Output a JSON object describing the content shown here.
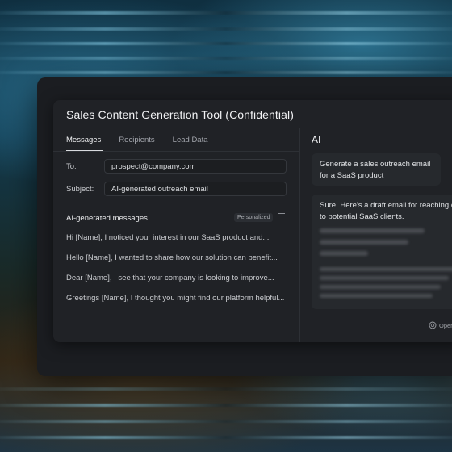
{
  "window": {
    "title": "Sales Content Generation Tool (Confidential)"
  },
  "tabs": [
    {
      "label": "Messages",
      "active": true
    },
    {
      "label": "Recipients",
      "active": false
    },
    {
      "label": "Lead Data",
      "active": false
    }
  ],
  "form": {
    "to_label": "To:",
    "to_value": "prospect@company.com",
    "subject_label": "Subject:",
    "subject_value": "AI-generated outreach email"
  },
  "messages": {
    "title": "AI-generated messages",
    "badge": "Personalized",
    "items": [
      "Hi [Name], I noticed your interest in our SaaS product and...",
      "Hello [Name], I wanted to share how our solution can benefit...",
      "Dear [Name], I see that your company is looking to improve...",
      "Greetings [Name], I thought you might find our platform helpful..."
    ]
  },
  "ai": {
    "title": "AI",
    "user_prompt": "Generate a sales outreach email for a SaaS product",
    "response_intro": "Sure! Here's a draft email for reaching out to potential SaaS clients.",
    "provider": "Oper"
  }
}
